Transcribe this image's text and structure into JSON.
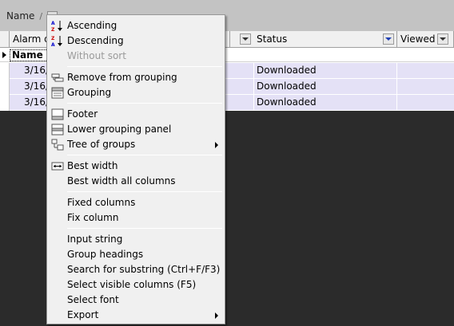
{
  "group_panel": {
    "chip_label": "Name",
    "chip_sort_mark": "/"
  },
  "grid": {
    "columns": [
      {
        "label": "Alarm d"
      },
      {
        "label": "Status"
      },
      {
        "label": "Viewed"
      }
    ],
    "group_row_label": "Name :",
    "rows": [
      {
        "date": "3/16/",
        "status": "Downloaded",
        "viewed": ""
      },
      {
        "date": "3/16/",
        "status": "Downloaded",
        "viewed": ""
      },
      {
        "date": "3/16/",
        "status": "Downloaded",
        "viewed": ""
      }
    ]
  },
  "menu": {
    "items": [
      {
        "label": "Ascending",
        "icon": "sort-ascending-icon",
        "enabled": true
      },
      {
        "label": "Descending",
        "icon": "sort-descending-icon",
        "enabled": true
      },
      {
        "label": "Without sort",
        "enabled": false
      },
      {
        "label": "Remove from grouping",
        "icon": "remove-grouping-icon",
        "enabled": true
      },
      {
        "label": "Grouping",
        "icon": "grouping-icon",
        "enabled": true
      },
      {
        "label": "Footer",
        "icon": "footer-icon",
        "enabled": true
      },
      {
        "label": "Lower grouping panel",
        "icon": "lower-grouping-panel-icon",
        "enabled": true
      },
      {
        "label": "Tree of groups",
        "icon": "tree-of-groups-icon",
        "enabled": true,
        "submenu": true
      },
      {
        "label": "Best width",
        "icon": "best-width-icon",
        "enabled": true
      },
      {
        "label": "Best width all columns",
        "enabled": true
      },
      {
        "label": "Fixed columns",
        "enabled": true
      },
      {
        "label": "Fix column",
        "enabled": true
      },
      {
        "label": "Input string",
        "enabled": true
      },
      {
        "label": "Group headings",
        "enabled": true
      },
      {
        "label": "Search for substring (Ctrl+F/F3)",
        "enabled": true
      },
      {
        "label": "Select visible columns (F5)",
        "enabled": true
      },
      {
        "label": "Select font",
        "enabled": true
      },
      {
        "label": "Export",
        "enabled": true,
        "submenu": true
      }
    ]
  },
  "colors": {
    "background": "#2b2b2b",
    "group_panel": "#c3c3c3",
    "row_highlight": "#e4e1f6",
    "menu_bg": "#f0f0f0",
    "disabled_text": "#9a9a9a",
    "filter_accent": "#1f3fb3"
  }
}
